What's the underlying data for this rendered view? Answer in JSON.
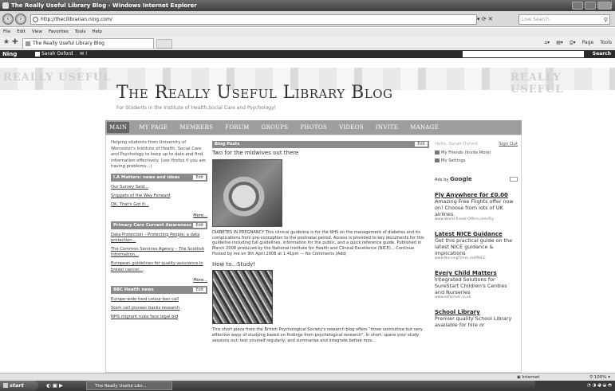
{
  "window": {
    "title": "The Really Useful Library Blog - Windows Internet Explorer"
  },
  "addressbar": {
    "url": "http://thecilibrarian.ning.com/",
    "search_placeholder": "Live Search"
  },
  "menu": [
    "File",
    "Edit",
    "View",
    "Favorites",
    "Tools",
    "Help"
  ],
  "tab": {
    "label": "The Really Useful Library Blog"
  },
  "commandbar": [
    "Page",
    "Tools"
  ],
  "ning": {
    "logo": "Ning",
    "user": "Sarah Oxford",
    "search_button": "Search"
  },
  "watermark": "REALLY USEFUL",
  "blog": {
    "title": "The Really Useful Library Blog",
    "subtitle": "For Students in the Institute of Health,Social Care and Psychology!"
  },
  "nav": [
    "Main",
    "My Page",
    "Members",
    "Forum",
    "Groups",
    "Photos",
    "Videos",
    "Invite",
    "Manage"
  ],
  "left": {
    "intro": "Helping students from University of Worcester's Institute of Health, Social Care and Psychology to keep up to date and find information effectively. (use firefox if you are having problems...)",
    "edit_label": "Edit",
    "more_label": "More...",
    "boxes": [
      {
        "title": "I.A Matters: news and ideas",
        "links": [
          "Our Survey Said...",
          "Snippets of the Way Forward",
          "OK, That's Got It..."
        ]
      },
      {
        "title": "Primary Care Current Awareness",
        "links": [
          "Data Protection – Protecting People: a data protection...",
          "The Common Services Agency – The Scottish Information...",
          "European guidelines for quality assurance in breast cancer..."
        ]
      },
      {
        "title": "BBC Health news",
        "links": [
          "Europe-wide food colour ban call",
          "Stem cell pioneer backs research",
          "NHS migrant rules face legal bid"
        ]
      }
    ]
  },
  "center": {
    "section_title": "Blog Posts",
    "edit_label": "Edit",
    "post1": {
      "title": "Two for the midwives out there",
      "body": "DIABETES IN PREGNANCY This clinical guideline is for the NHS on the management of diabetes and its complications from pre-conception to the postnatal period. Access is provided to key documents for this guideline including full guidelines, information for the public, and a quick reference guide. Published in March 2008 produced by the National Institute for Health and Clinical Excellence (NICE)... Continue",
      "meta": "Posted by me on 9th April 2008 at 1:41pm — No Comments (Add)"
    },
    "post2": {
      "title": "How to...Study!",
      "body": "This short piece from the British Psychological Society's research blog offers \"three unintuitive but very effective ways of studying based on findings from psychological research\". In short: space your study sessions out; test yourself regularly; and summarise and integrate before mov..."
    }
  },
  "right": {
    "hello": "Hello, Sarah Oxford",
    "sign_out": "Sign Out",
    "my_friends": "My Friends (Invite More)",
    "my_settings": "My Settings",
    "ads_by": "Ads by",
    "google": "Google",
    "ads": [
      {
        "title": "Fly Anywhere for £0.00",
        "text": "Amazing Free Flights offer now on! Choose from lots of UK airlines.",
        "url": "www.World-Travel-Offers.com/Fly"
      },
      {
        "title": "Latest NICE Guidance",
        "text": "Get this practical guide on the latest NICE guidance & implications",
        "url": "www.NursingTimes.net/NICE"
      },
      {
        "title": "Every Child Matters",
        "text": "Integrated Solutions for SureStart Children's Centres and Nurseries",
        "url": "www.esfarrest.co.uk"
      },
      {
        "title": "School Library",
        "text": "Premier quality School Library available for hire or",
        "url": ""
      }
    ]
  },
  "status": {
    "zone": "Internet",
    "zoom": "100%"
  },
  "taskbar": {
    "start": "start",
    "task": "The Really Useful Libr..."
  }
}
